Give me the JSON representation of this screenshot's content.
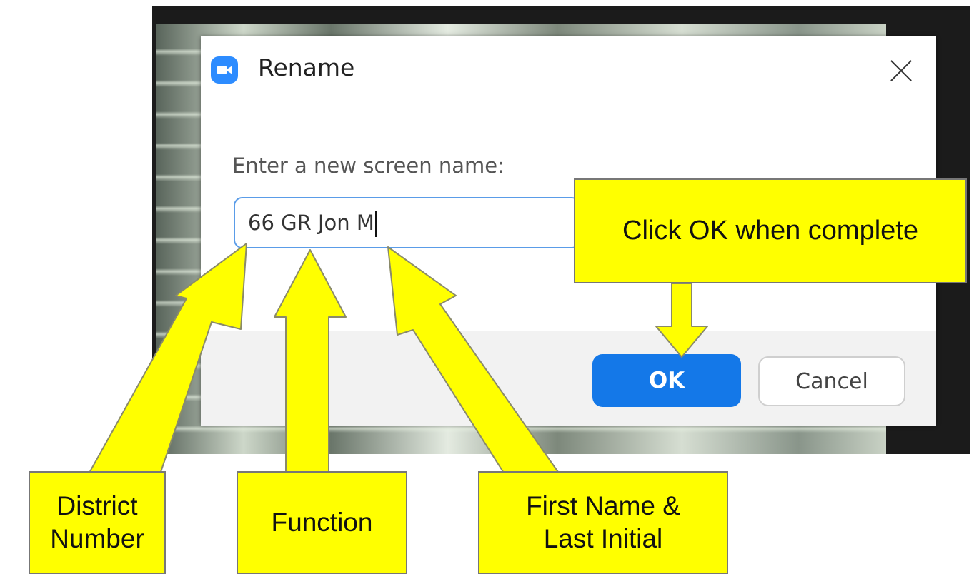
{
  "dialog": {
    "title": "Rename",
    "app_icon": "zoom-camera-icon",
    "close_icon": "close-icon",
    "prompt": "Enter a new screen name:",
    "input_value": "66 GR Jon M",
    "ok_label": "OK",
    "cancel_label": "Cancel"
  },
  "callouts": {
    "ok": "Click OK when complete",
    "district": "District\nNumber",
    "function": "Function",
    "name": "First Name &\nLast Initial"
  },
  "colors": {
    "accent": "#1478e8",
    "callout": "#ffff00",
    "input_border": "#5a9ce8",
    "app_icon": "#2d8cff"
  }
}
